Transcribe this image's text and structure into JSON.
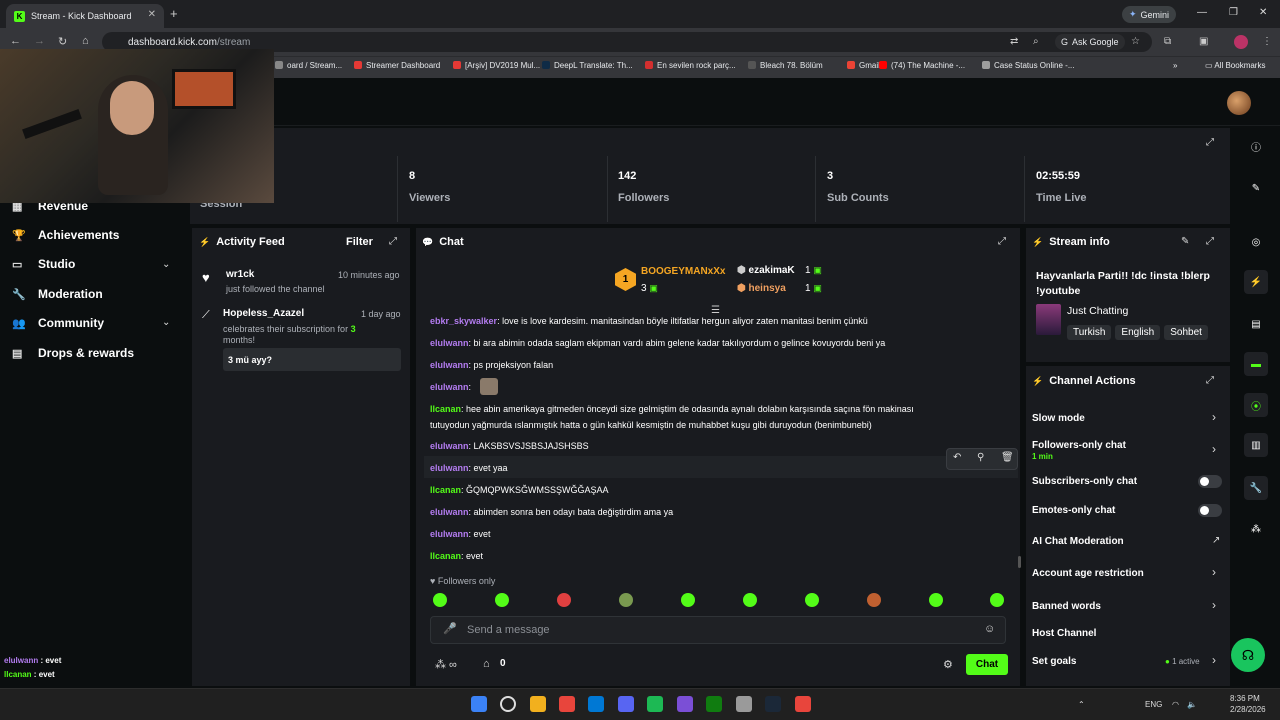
{
  "browser": {
    "tab_title": "Stream - Kick Dashboard",
    "favicon_letter": "K",
    "gemini_label": "Gemini",
    "url_host": "dashboard.kick.com",
    "url_path": "/stream",
    "ask_google": "Ask Google",
    "all_bookmarks": "All Bookmarks",
    "bookmarks": [
      {
        "label": "oard / Stream...",
        "color": "#888"
      },
      {
        "label": "Streamer Dashboard",
        "color": "#e53935"
      },
      {
        "label": "[Arşiv] DV2019 Mul...",
        "color": "#e53935"
      },
      {
        "label": "DeepL Translate: Th...",
        "color": "#0f2b46"
      },
      {
        "label": "En sevilen rock parç...",
        "color": "#d32f2f"
      },
      {
        "label": "Bleach 78. Bölüm",
        "color": "#555"
      },
      {
        "label": "Gmail",
        "color": "#ea4335"
      },
      {
        "label": "(74) The Machine -...",
        "color": "#ff0000"
      },
      {
        "label": "Case Status Online -...",
        "color": "#9e9e9e"
      }
    ]
  },
  "sidebar": {
    "items": [
      {
        "label": "Revenue",
        "icon": "chart-icon"
      },
      {
        "label": "Achievements",
        "icon": "trophy-icon"
      },
      {
        "label": "Studio",
        "icon": "studio-icon"
      },
      {
        "label": "Moderation",
        "icon": "wrench-icon"
      },
      {
        "label": "Community",
        "icon": "people-icon"
      },
      {
        "label": "Drops & rewards",
        "icon": "gift-icon"
      }
    ],
    "chat_overlay": [
      {
        "user": "elulwann",
        "text": "evet"
      },
      {
        "user": "llcanan",
        "text": "evet"
      }
    ]
  },
  "stats": {
    "session_label": "Session",
    "viewers": {
      "value": "8",
      "label": "Viewers"
    },
    "followers": {
      "value": "142",
      "label": "Followers"
    },
    "subs": {
      "value": "3",
      "label": "Sub Counts"
    },
    "time": {
      "value": "02:55:59",
      "label": "Time Live"
    }
  },
  "activity": {
    "title": "Activity Feed",
    "filter": "Filter",
    "items": [
      {
        "user": "wr1ck",
        "time": "10 minutes ago",
        "text": "just followed the channel"
      },
      {
        "user": "Hopeless_Azazel",
        "time": "1 day ago",
        "text_a": "celebrates their subscription for ",
        "count": "3",
        "text_b": "months!",
        "message": "3 mü ayy?"
      }
    ]
  },
  "chat": {
    "title": "Chat",
    "leaders": {
      "first": {
        "name": "BOOGEYMANxXx",
        "rank": "1",
        "count": "3"
      },
      "second": {
        "name": "ezakimaK",
        "count": "1"
      },
      "third": {
        "name": "heinsya",
        "count": "1"
      }
    },
    "messages": [
      {
        "user": "ebkr_skywalker",
        "color": "p",
        "text": "love is love kardesim. manitasindan böyle iltifatlar hergun aliyor zaten manitasi benim çünkü"
      },
      {
        "user": "elulwann",
        "color": "p",
        "text": "bi ara abimin odada saglam ekipman vardı abim gelene kadar takılıyordum o gelince kovuyordu beni ya"
      },
      {
        "user": "elulwann",
        "color": "p",
        "text": "ps projeksiyon falan"
      },
      {
        "user": "elulwann",
        "color": "p",
        "text": ""
      },
      {
        "user": "llcanan",
        "color": "g",
        "text": "hee abin amerikaya gitmeden önceydi size gelmiştim de odasında aynalı dolabın karşısında saçına fön makinası"
      },
      {
        "user": "",
        "color": "g",
        "text": "tutuyodun yağmurda ıslanmıştık hatta o gün kahkül kesmiştin de muhabbet kuşu gibi duruyodun (benimbunebi)"
      },
      {
        "user": "elulwann",
        "color": "p",
        "text": "LAKSBSVSJSBSJAJSHSBS"
      },
      {
        "user": "elulwann",
        "color": "p",
        "text": "evet yaa"
      },
      {
        "user": "llcanan",
        "color": "g",
        "text": "ĞQMQPWKSĞWMSSŞWĞĞAŞAA"
      },
      {
        "user": "elulwann",
        "color": "p",
        "text": "abimden sonra ben odayı bata değiştirdim ama ya"
      },
      {
        "user": "elulwann",
        "color": "p",
        "text": "evet"
      },
      {
        "user": "llcanan",
        "color": "g",
        "text": "evet"
      }
    ],
    "followers_only": "Followers only",
    "placeholder": "Send a message",
    "points": "0",
    "send_label": "Chat"
  },
  "stream_info": {
    "title": "Stream info",
    "stream_title": "Hayvanlarla Parti!! !dc !insta !blerp !youtube",
    "category": "Just Chatting",
    "tags": [
      "Turkish",
      "English",
      "Sohbet"
    ]
  },
  "channel_actions": {
    "title": "Channel Actions",
    "slow_mode": "Slow mode",
    "followers_only": "Followers-only chat",
    "followers_only_sub": "1 min",
    "subs_only": "Subscribers-only chat",
    "emotes_only": "Emotes-only chat",
    "ai_mod": "AI Chat Moderation",
    "account_age": "Account age restriction",
    "banned_words": "Banned words",
    "host": "Host Channel",
    "goals": "Set goals",
    "goals_status": "1 active"
  },
  "taskbar": {
    "lang": "ENG",
    "time": "8:36 PM",
    "date": "2/28/2026"
  },
  "colors": {
    "accent": "#53fc18",
    "panel": "#191b1f",
    "bg": "#0b0e0f",
    "user_purple": "#b37cf0"
  }
}
